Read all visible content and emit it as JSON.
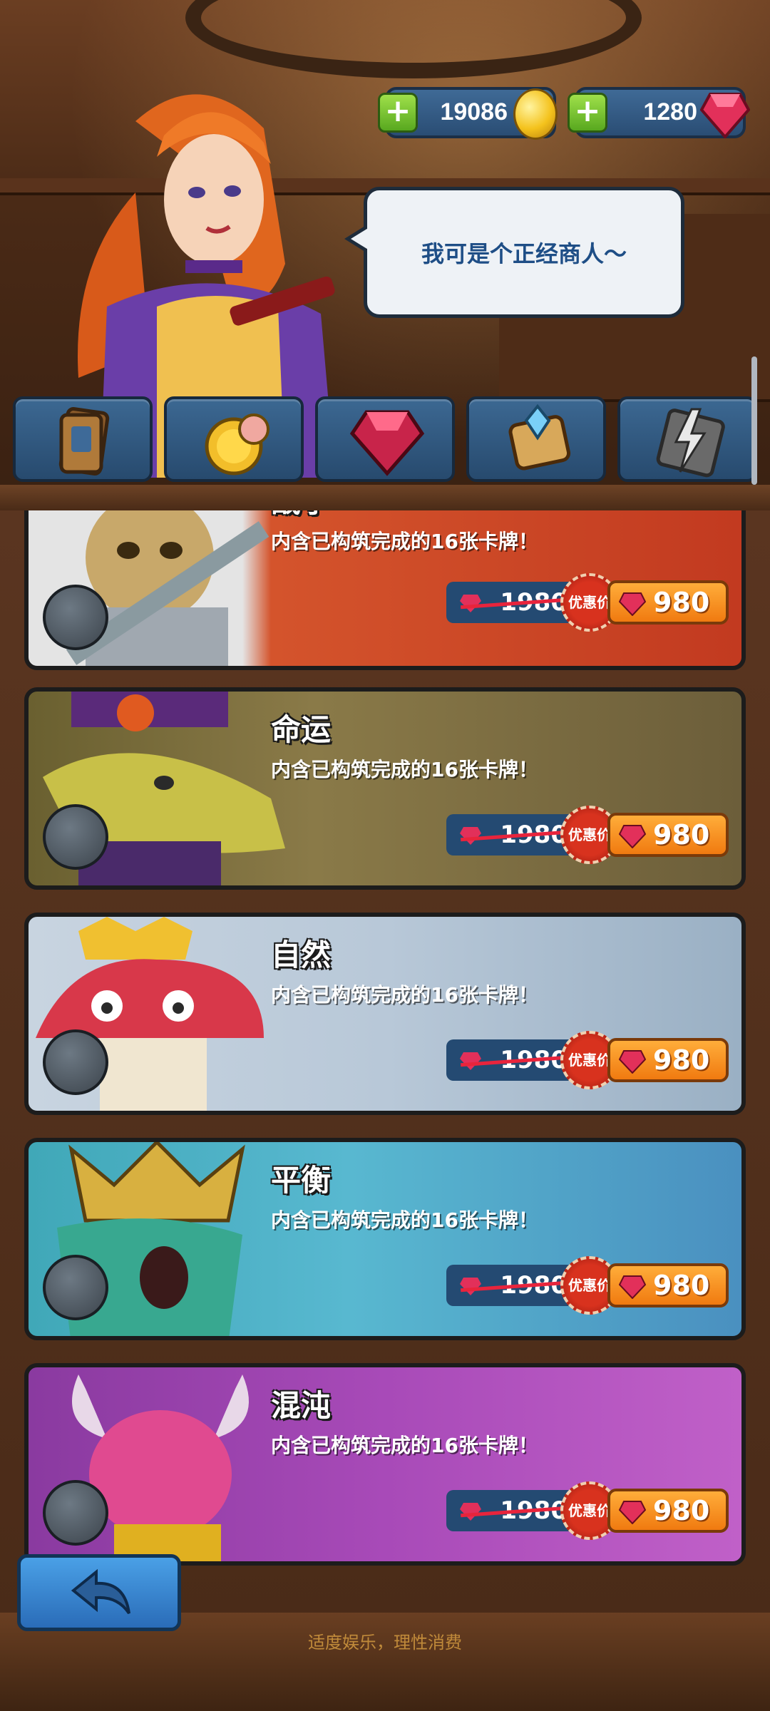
{
  "currency": {
    "gold": "19086",
    "gems": "1280"
  },
  "merchant": {
    "speech": "我可是个正经商人～"
  },
  "tabs": [
    {
      "icon": "card-deck-icon"
    },
    {
      "icon": "gold-pouch-icon"
    },
    {
      "icon": "ruby-gem-icon"
    },
    {
      "icon": "scroll-crystal-icon"
    },
    {
      "icon": "lightning-card-icon"
    }
  ],
  "packs": [
    {
      "title": "战争",
      "desc": "内含已构筑完成的16张卡牌！",
      "old_price": "1980",
      "deal": "优惠价",
      "price": "980",
      "theme": "#c8522c"
    },
    {
      "title": "命运",
      "desc": "内含已构筑完成的16张卡牌！",
      "old_price": "1980",
      "deal": "优惠价",
      "price": "980",
      "theme": "#7a6436"
    },
    {
      "title": "自然",
      "desc": "内含已构筑完成的16张卡牌！",
      "old_price": "1980",
      "deal": "优惠价",
      "price": "980",
      "theme": "#b8c8d8"
    },
    {
      "title": "平衡",
      "desc": "内含已构筑完成的16张卡牌！",
      "old_price": "1980",
      "deal": "优惠价",
      "price": "980",
      "theme": "#58b8d0"
    },
    {
      "title": "混沌",
      "desc": "内含已构筑完成的16张卡牌！",
      "old_price": "1980",
      "deal": "优惠价",
      "price": "980",
      "theme": "#a84ab8"
    }
  ],
  "footer": {
    "notice": "适度娱乐，理性消费"
  }
}
